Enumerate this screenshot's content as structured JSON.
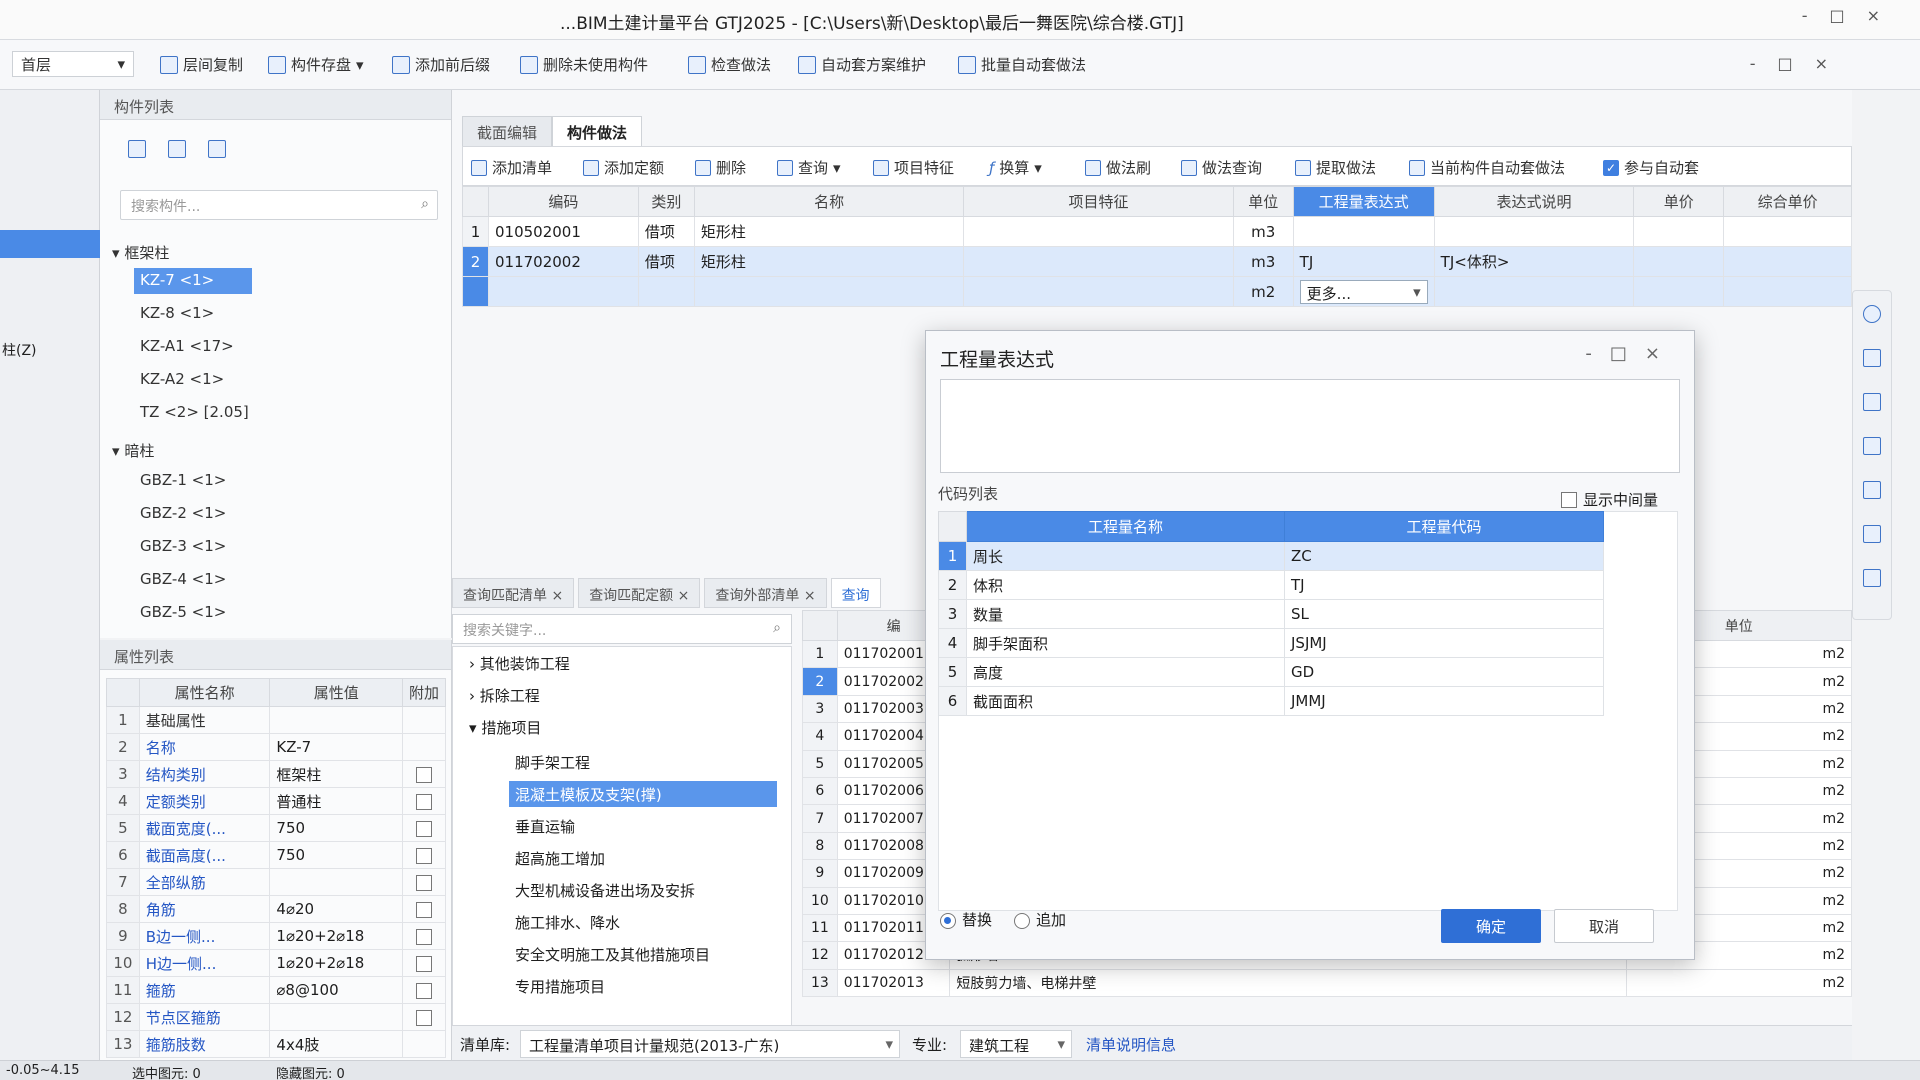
{
  "window": {
    "title": "...BIM土建计量平台 GTJ2025 - [C:\\Users\\新\\Desktop\\最后一舞医院\\综合楼.GTJ]",
    "controls": [
      "-",
      "□",
      "×"
    ]
  },
  "toolbar1": {
    "floor_select": "首层",
    "items": [
      "层间复制",
      "构件存盘",
      "添加前后缀",
      "删除未使用构件",
      "检查做法",
      "自动套方案维护",
      "批量自动套做法"
    ]
  },
  "left_rail": {
    "label": "柱(Z)"
  },
  "component_list": {
    "header": "构件列表",
    "search_placeholder": "搜索构件...",
    "groups": [
      {
        "label": "框架柱",
        "items": [
          "KZ-7 <1>",
          "KZ-8 <1>",
          "KZ-A1 <17>",
          "KZ-A2 <1>",
          "TZ <2> [2.05]"
        ]
      },
      {
        "label": "暗柱",
        "items": [
          "GBZ-1 <1>",
          "GBZ-2 <1>",
          "GBZ-3 <1>",
          "GBZ-4 <1>",
          "GBZ-5 <1>"
        ]
      }
    ]
  },
  "property_list": {
    "header": "属性列表",
    "columns": [
      "属性名称",
      "属性值",
      "附加"
    ],
    "rows": [
      {
        "n": "1",
        "name": "基础属性",
        "value": "",
        "add": false
      },
      {
        "n": "2",
        "name": "名称",
        "value": "KZ-7",
        "add": false
      },
      {
        "n": "3",
        "name": "结构类别",
        "value": "框架柱",
        "add": true
      },
      {
        "n": "4",
        "name": "定额类别",
        "value": "普通柱",
        "add": true
      },
      {
        "n": "5",
        "name": "截面宽度(...",
        "value": "750",
        "add": true
      },
      {
        "n": "6",
        "name": "截面高度(...",
        "value": "750",
        "add": true
      },
      {
        "n": "7",
        "name": "全部纵筋",
        "value": "",
        "add": true
      },
      {
        "n": "8",
        "name": "角筋",
        "value": "4⌀20",
        "add": true
      },
      {
        "n": "9",
        "name": "B边一侧...",
        "value": "1⌀20+2⌀18",
        "add": true
      },
      {
        "n": "10",
        "name": "H边一侧...",
        "value": "1⌀20+2⌀18",
        "add": true
      },
      {
        "n": "11",
        "name": "箍筋",
        "value": "⌀8@100",
        "add": true
      },
      {
        "n": "12",
        "name": "节点区箍筋",
        "value": "",
        "add": true
      },
      {
        "n": "13",
        "name": "箍筋肢数",
        "value": "4x4肢",
        "add": false
      }
    ]
  },
  "main": {
    "tabs": [
      "截面编辑",
      "构件做法"
    ],
    "active_tab": 1,
    "toolbar": [
      "添加清单",
      "添加定额",
      "删除",
      "查询",
      "项目特征",
      "换算",
      "做法刷",
      "做法查询",
      "提取做法",
      "当前构件自动套做法",
      "参与自动套"
    ],
    "boq_columns": [
      "编码",
      "类别",
      "名称",
      "项目特征",
      "单位",
      "工程量表达式",
      "表达式说明",
      "单价",
      "综合单价"
    ],
    "boq_rows": [
      {
        "n": "1",
        "code": "010502001",
        "type": "借项",
        "name": "矩形柱",
        "feature": "",
        "unit": "m3",
        "expr": "",
        "desc": ""
      },
      {
        "n": "2",
        "code": "011702002",
        "type": "借项",
        "name": "矩形柱",
        "feature": "",
        "unit": "m3",
        "expr": "TJ",
        "desc": "TJ<体积>"
      },
      {
        "n": "",
        "code": "",
        "type": "",
        "name": "",
        "feature": "",
        "unit": "m2",
        "expr": "更多...",
        "desc": ""
      }
    ],
    "lower_tabs": [
      "查询匹配清单",
      "查询匹配定额",
      "查询外部清单",
      "查询"
    ],
    "lower_search_placeholder": "搜索关键字...",
    "lower_tree": [
      {
        "kind": "group",
        "label": "其他装饰工程"
      },
      {
        "kind": "group",
        "label": "拆除工程"
      },
      {
        "kind": "group",
        "label": "措施项目"
      },
      {
        "kind": "item",
        "label": "脚手架工程"
      },
      {
        "kind": "item",
        "label": "混凝土模板及支架(撑)"
      },
      {
        "kind": "item",
        "label": "垂直运输"
      },
      {
        "kind": "item",
        "label": "超高施工增加"
      },
      {
        "kind": "item",
        "label": "大型机械设备进出场及安拆"
      },
      {
        "kind": "item",
        "label": "施工排水、降水"
      },
      {
        "kind": "item",
        "label": "安全文明施工及其他措施项目"
      },
      {
        "kind": "item",
        "label": "专用措施项目"
      }
    ],
    "code_list_columns": [
      "编",
      "单位"
    ],
    "code_list": [
      {
        "n": "1",
        "code": "011702001",
        "name": "",
        "unit": "m2"
      },
      {
        "n": "2",
        "code": "011702002",
        "name": "",
        "unit": "m2"
      },
      {
        "n": "3",
        "code": "011702003",
        "name": "",
        "unit": "m2"
      },
      {
        "n": "4",
        "code": "011702004",
        "name": "",
        "unit": "m2"
      },
      {
        "n": "5",
        "code": "011702005",
        "name": "",
        "unit": "m2"
      },
      {
        "n": "6",
        "code": "011702006",
        "name": "",
        "unit": "m2"
      },
      {
        "n": "7",
        "code": "011702007",
        "name": "",
        "unit": "m2"
      },
      {
        "n": "8",
        "code": "011702008",
        "name": "",
        "unit": "m2"
      },
      {
        "n": "9",
        "code": "011702009",
        "name": "",
        "unit": "m2"
      },
      {
        "n": "10",
        "code": "011702010",
        "name": "",
        "unit": "m2"
      },
      {
        "n": "11",
        "code": "011702011",
        "name": "",
        "unit": "m2"
      },
      {
        "n": "12",
        "code": "011702012",
        "name": "弧形墙",
        "unit": "m2"
      },
      {
        "n": "13",
        "code": "011702013",
        "name": "短肢剪力墙、电梯井壁",
        "unit": "m2"
      }
    ],
    "bottom": {
      "lib_label": "清单库:",
      "lib_value": "工程量清单项目计量规范(2013-广东)",
      "major_label": "专业:",
      "major_value": "建筑工程",
      "info": "清单说明信息"
    }
  },
  "status_bar": {
    "elevation": "-0.05~4.15",
    "selected": "选中图元: 0",
    "hidden": "隐藏图元: 0"
  },
  "dialog": {
    "title": "工程量表达式",
    "controls": [
      "-",
      "□",
      "×"
    ],
    "expr_value": "",
    "code_list_label": "代码列表",
    "show_mid": "显示中间量",
    "columns": [
      "工程量名称",
      "工程量代码"
    ],
    "rows": [
      {
        "n": "1",
        "name": "周长",
        "code": "ZC"
      },
      {
        "n": "2",
        "name": "体积",
        "code": "TJ"
      },
      {
        "n": "3",
        "name": "数量",
        "code": "SL"
      },
      {
        "n": "4",
        "name": "脚手架面积",
        "code": "JSJMJ"
      },
      {
        "n": "5",
        "name": "高度",
        "code": "GD"
      },
      {
        "n": "6",
        "name": "截面面积",
        "code": "JMMJ"
      }
    ],
    "radio_replace": "替换",
    "radio_append": "追加",
    "ok": "确定",
    "cancel": "取消"
  },
  "colors": {
    "accent": "#4a8ae6",
    "primary_button": "#2f6fd6",
    "link_text": "#2456c4"
  }
}
